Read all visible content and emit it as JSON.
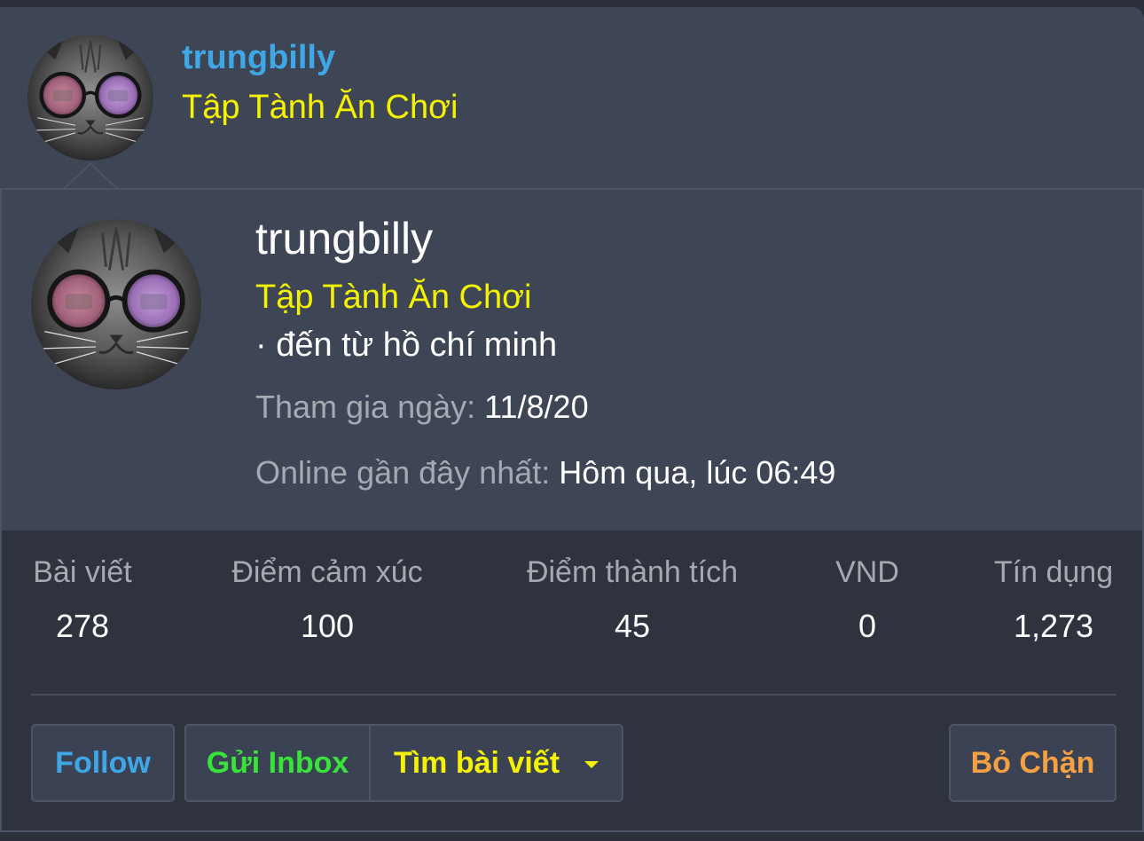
{
  "header": {
    "username": "trungbilly",
    "user_title": "Tập Tành Ăn Chơi"
  },
  "profile": {
    "username": "trungbilly",
    "user_title": "Tập Tành Ăn Chơi",
    "location": "· đến từ hồ chí minh",
    "joined_label": "Tham gia ngày:",
    "joined_value": "11/8/20",
    "online_label": "Online gần đây nhất:",
    "online_value": "Hôm qua, lúc 06:49"
  },
  "stats": [
    {
      "label": "Bài viết",
      "value": "278"
    },
    {
      "label": "Điểm cảm xúc",
      "value": "100"
    },
    {
      "label": "Điểm thành tích",
      "value": "45"
    },
    {
      "label": "VND",
      "value": "0"
    },
    {
      "label": "Tín dụng",
      "value": "1,273"
    }
  ],
  "actions": {
    "follow": "Follow",
    "inbox": "Gửi Inbox",
    "find_posts": "Tìm bài viết",
    "unblock": "Bỏ Chặn"
  },
  "colors": {
    "username": "#3fa7e6",
    "user_title": "#f5f200",
    "inbox": "#39e43a",
    "unblock": "#f5a043"
  },
  "icons": {
    "find_posts_dropdown": "caret-down-icon",
    "avatar": "cat-with-sunglasses-avatar"
  }
}
